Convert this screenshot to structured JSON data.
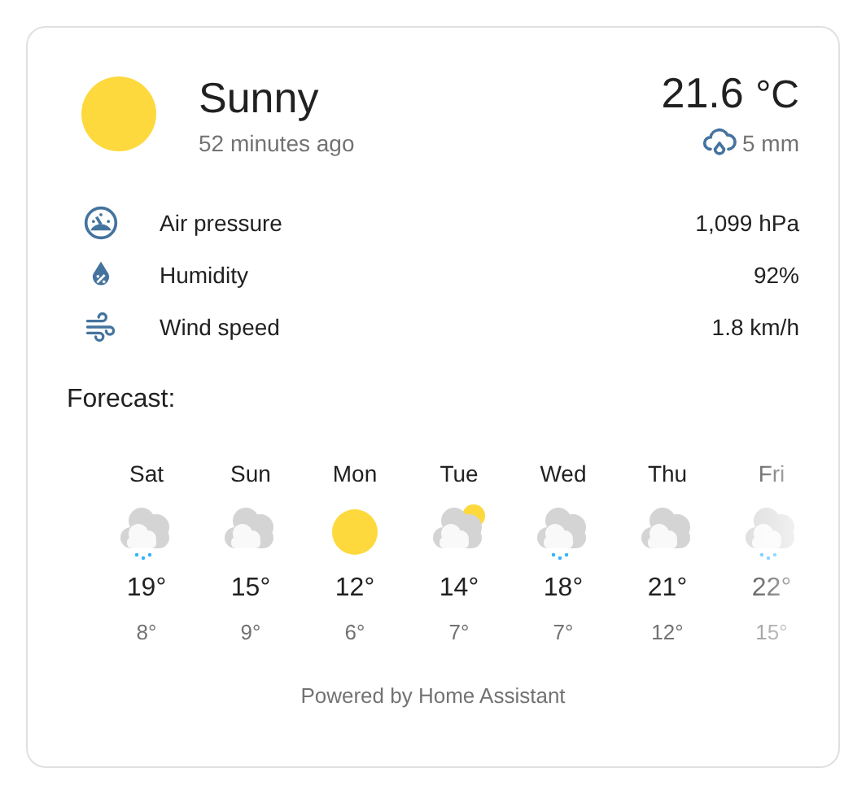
{
  "current": {
    "condition": "Sunny",
    "kind": "sunny",
    "updated": "52 minutes ago",
    "temperature": "21.6",
    "unit": "°C",
    "precipitation": "5 mm"
  },
  "attributes": [
    {
      "kind": "pressure",
      "label": "Air pressure",
      "value": "1,099 hPa"
    },
    {
      "kind": "humidity",
      "label": "Humidity",
      "value": "92%"
    },
    {
      "kind": "wind",
      "label": "Wind speed",
      "value": "1.8 km/h"
    }
  ],
  "forecast_title": "Forecast:",
  "forecast": [
    {
      "day": "Sat",
      "kind": "rainy",
      "high": "19°",
      "low": "8°"
    },
    {
      "day": "Sun",
      "kind": "cloudy",
      "high": "15°",
      "low": "9°"
    },
    {
      "day": "Mon",
      "kind": "sunny",
      "high": "12°",
      "low": "6°"
    },
    {
      "day": "Tue",
      "kind": "partlycloudy",
      "high": "14°",
      "low": "7°"
    },
    {
      "day": "Wed",
      "kind": "rainy",
      "high": "18°",
      "low": "7°"
    },
    {
      "day": "Thu",
      "kind": "cloudy",
      "high": "21°",
      "low": "12°"
    },
    {
      "day": "Fri",
      "kind": "rainy",
      "high": "22°",
      "low": "15°"
    }
  ],
  "footer": "Powered by Home Assistant"
}
